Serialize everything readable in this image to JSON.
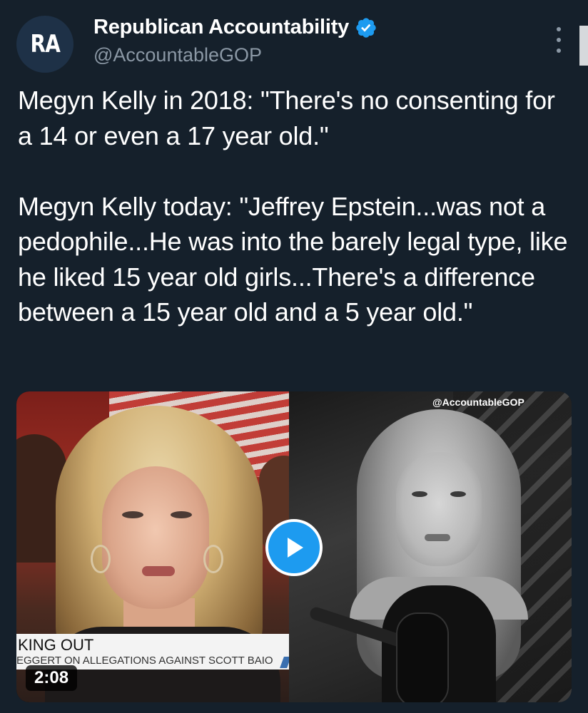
{
  "author": {
    "avatar_text": "RA",
    "display_name": "Republican Accountability",
    "handle": "@AccountableGOP",
    "verified": true
  },
  "tweet": {
    "text": "Megyn Kelly in 2018: \"There's no consenting for a 14 or even a 17 year old.\"\n\nMegyn Kelly today: \"Jeffrey Epstein...was not a pedophile...He was into the barely legal type, like he liked 15 year old girls...There's a difference between a 15 year old and a 5 year old.\""
  },
  "media": {
    "watermark": "@AccountableGOP",
    "lower_third_title": "KING OUT",
    "lower_third_subtitle": "EGGERT ON ALLEGATIONS AGAINST SCOTT BAIO",
    "duration": "2:08"
  },
  "icons": {
    "verified": "verified-badge-icon",
    "more": "more-options-icon",
    "play": "play-icon"
  },
  "colors": {
    "background": "#15202b",
    "accent": "#1d9bf0",
    "secondary_text": "#8b98a5"
  }
}
